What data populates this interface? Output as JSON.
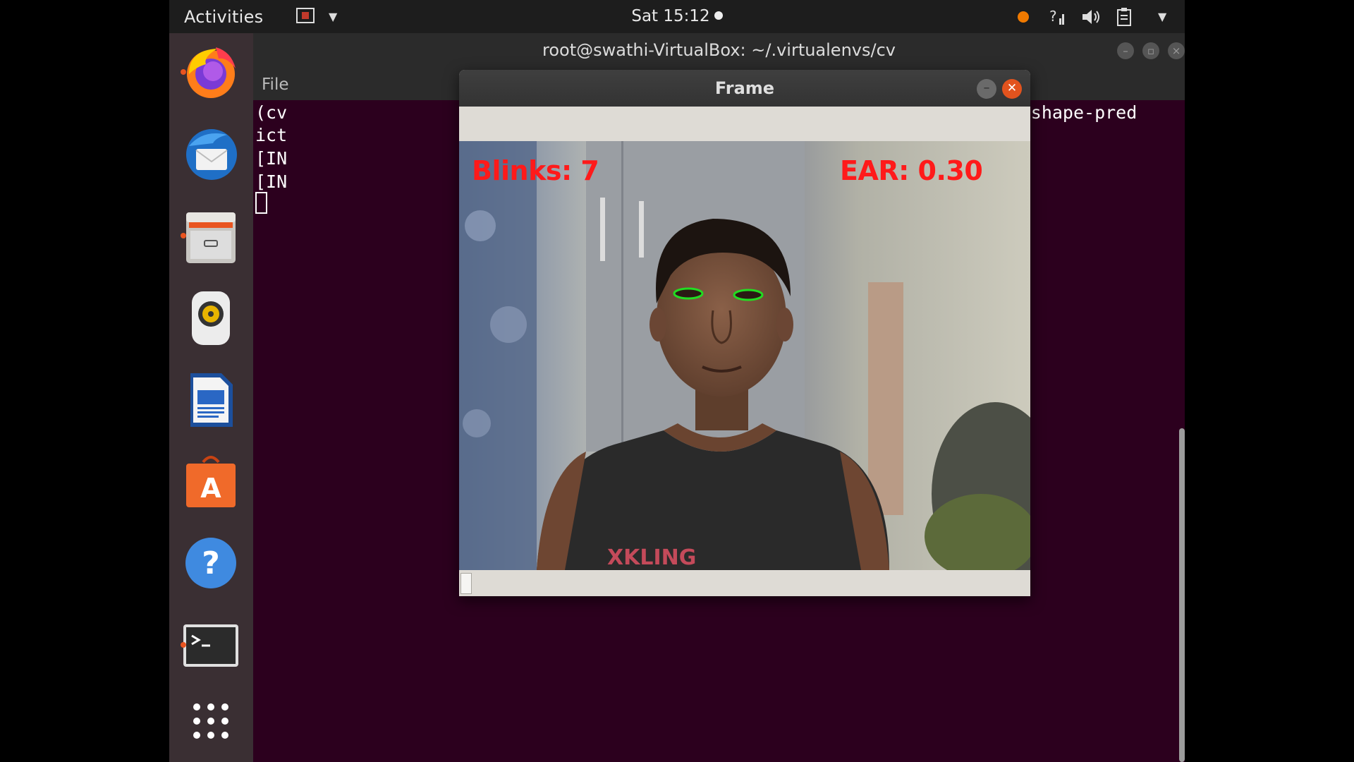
{
  "topbar": {
    "activities": "Activities",
    "clock": "Sat 15:12",
    "status_icons": [
      "notification-dot-icon",
      "network-question-icon",
      "volume-icon",
      "clipboard-icon",
      "chevron-down-icon"
    ]
  },
  "dock": {
    "items": [
      {
        "name": "firefox",
        "running": true
      },
      {
        "name": "thunderbird",
        "running": false
      },
      {
        "name": "files",
        "running": true
      },
      {
        "name": "rhythmbox",
        "running": false
      },
      {
        "name": "libreoffice-writer",
        "running": false
      },
      {
        "name": "ubuntu-software",
        "running": false
      },
      {
        "name": "help",
        "running": false
      },
      {
        "name": "terminal",
        "running": true
      },
      {
        "name": "show-applications",
        "running": false
      }
    ]
  },
  "terminal": {
    "title": "root@swathi-VirtualBox: ~/.virtualenvs/cv",
    "menu_file": "File",
    "lines": [
      "(cv",
      "ict",
      "[IN",
      "[IN"
    ],
    "right_text": "eyeblinks.py --shape-pred"
  },
  "frame_window": {
    "title": "Frame",
    "blinks_label": "Blinks: 7",
    "ear_label": "EAR: 0.30"
  },
  "colors": {
    "terminal_bg": "#2c001e",
    "overlay_text": "#ff1a1a",
    "eye_contour": "#22dd22",
    "close_button": "#e2531e",
    "accent_dot": "#e95420"
  }
}
